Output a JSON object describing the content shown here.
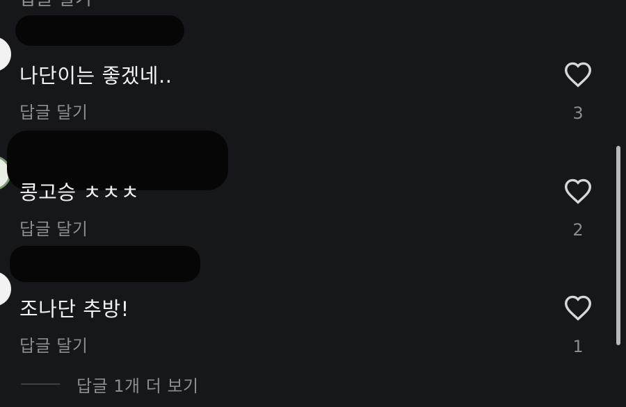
{
  "previous_comment": {
    "reply_label": "답글 달기"
  },
  "comments": [
    {
      "text": "나단이는 좋겠네..",
      "reply_label": "답글 달기",
      "like_count": "3"
    },
    {
      "text": "콩고승 ㅊㅊㅊ",
      "reply_label": "답글 달기",
      "like_count": "2"
    },
    {
      "text": "조나단 추방!",
      "reply_label": "답글 달기",
      "like_count": "1"
    }
  ],
  "more_replies": {
    "label": "답글 1개 더 보기"
  },
  "icons": {
    "like": "heart-outline-icon"
  },
  "colors": {
    "background": "#16171a",
    "primary_text": "#f1f1f1",
    "secondary_text": "#8b8d93",
    "redaction": "#060606"
  }
}
